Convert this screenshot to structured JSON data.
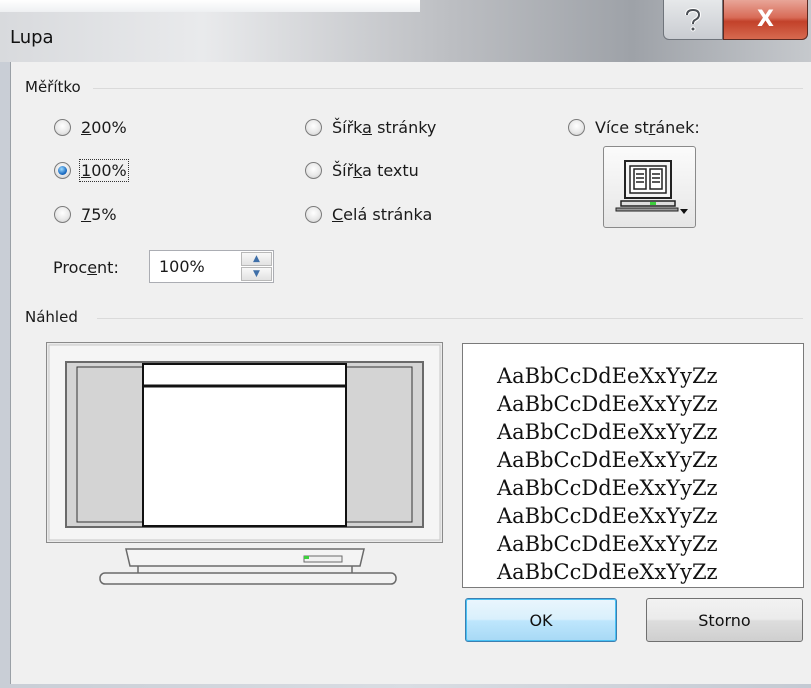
{
  "window": {
    "title": "Lupa",
    "help_glyph": "?",
    "close_glyph": "X"
  },
  "zoom_group": {
    "header": "Měřítko",
    "options": [
      {
        "pre": "",
        "key": "2",
        "post": "00%",
        "checked": false
      },
      {
        "pre": "",
        "key": "1",
        "post": "00%",
        "checked": true
      },
      {
        "pre": "",
        "key": "7",
        "post": "5%",
        "checked": false
      },
      {
        "pre": "Šířk",
        "key": "a",
        "post": " stránky",
        "checked": false
      },
      {
        "pre": "Šíř",
        "key": "k",
        "post": "a textu",
        "checked": false
      },
      {
        "pre": "",
        "key": "C",
        "post": "elá stránka",
        "checked": false
      },
      {
        "pre": "Více st",
        "key": "r",
        "post": "ánek:",
        "checked": false
      }
    ],
    "percent": {
      "label_pre": "Proc",
      "label_key": "e",
      "label_post": "nt:",
      "value": "100%"
    }
  },
  "preview_group": {
    "header": "Náhled",
    "sample_text": "AaBbCcDdEeXxYyZz"
  },
  "buttons": {
    "ok": "OK",
    "cancel": "Storno"
  },
  "icons": [
    "help-icon",
    "close-icon",
    "multi-page-monitor-icon",
    "spin-up-icon",
    "spin-down-icon"
  ]
}
